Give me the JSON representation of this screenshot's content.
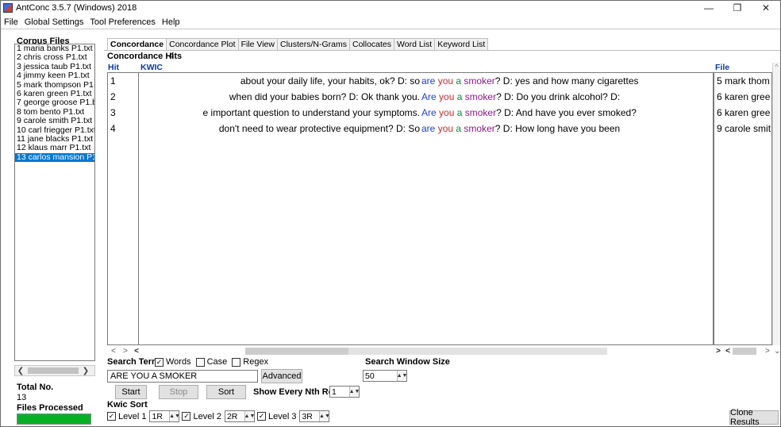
{
  "window": {
    "title": "AntConc 3.5.7 (Windows) 2018",
    "minimize": "—",
    "maximize": "❐",
    "close": "✕"
  },
  "menu": [
    "File",
    "Global Settings",
    "Tool Preferences",
    "Help"
  ],
  "left": {
    "corpus_files_label": "Corpus Files",
    "files": [
      "1 maria banks P1.txt",
      "2 chris cross P1.txt",
      "3 jessica taub P1.txt",
      "4 jimmy keen P1.txt",
      "5 mark thompson P1.t",
      "6 karen green P1.txt",
      "7 george groose P1.b",
      "8 tom bento P1.txt",
      "9 carole smith P1.txt",
      "10 carl friegger P1.txt",
      "11 jane blacks P1.txt",
      "12 klaus marr P1.txt",
      "13 carlos mansion P1."
    ],
    "selected_index": 12,
    "total_no_label": "Total No.",
    "total_no_value": "13",
    "files_processed_label": "Files Processed",
    "progress": 1.0
  },
  "tabs": [
    "Concordance",
    "Concordance Plot",
    "File View",
    "Clusters/N-Grams",
    "Collocates",
    "Word List",
    "Keyword List"
  ],
  "active_tab": 0,
  "concordance": {
    "hits_label": "Concordance Hits",
    "hits_count": "4",
    "col_hit": "Hit",
    "col_kwic": "KWIC",
    "col_file": "File",
    "rows": [
      {
        "hit": "1",
        "left": "about your daily life, your habits, ok? D: so",
        "kw": [
          "are",
          "you",
          "a",
          "smoker"
        ],
        "right": "? D: yes and how many cigarettes",
        "file": "5 mark thom"
      },
      {
        "hit": "2",
        "left": "when did your babies born? D: Ok thank you.",
        "kw": [
          "Are",
          "you",
          "a",
          "smoker"
        ],
        "right": "? D: Do you drink alcohol? D:",
        "file": "6 karen gree"
      },
      {
        "hit": "3",
        "left": "e important question to understand your symptoms.",
        "kw": [
          "Are",
          "you",
          "a",
          "smoker"
        ],
        "right": "? D: And have you ever smoked?",
        "file": "6 karen gree"
      },
      {
        "hit": "4",
        "left": "don't need to wear protective equipment? D: So",
        "kw": [
          "are",
          "you",
          "a",
          "smoker"
        ],
        "right": "? D: How long have you been",
        "file": "9 carole smit"
      }
    ]
  },
  "search": {
    "term_label": "Search Term",
    "words_label": "Words",
    "words_checked": true,
    "case_label": "Case",
    "case_checked": false,
    "regex_label": "Regex",
    "regex_checked": false,
    "term_value": "ARE YOU A SMOKER",
    "advanced_label": "Advanced",
    "window_size_label": "Search Window Size",
    "window_size_value": "50",
    "start_label": "Start",
    "stop_label": "Stop",
    "sort_label": "Sort",
    "nth_row_label": "Show Every Nth Row",
    "nth_row_value": "1"
  },
  "kwic_sort": {
    "label": "Kwic Sort",
    "level1_label": "Level 1",
    "level1_value": "1R",
    "level2_label": "Level 2",
    "level2_value": "2R",
    "level3_label": "Level 3",
    "level3_value": "3R",
    "clone_label": "Clone Results"
  }
}
